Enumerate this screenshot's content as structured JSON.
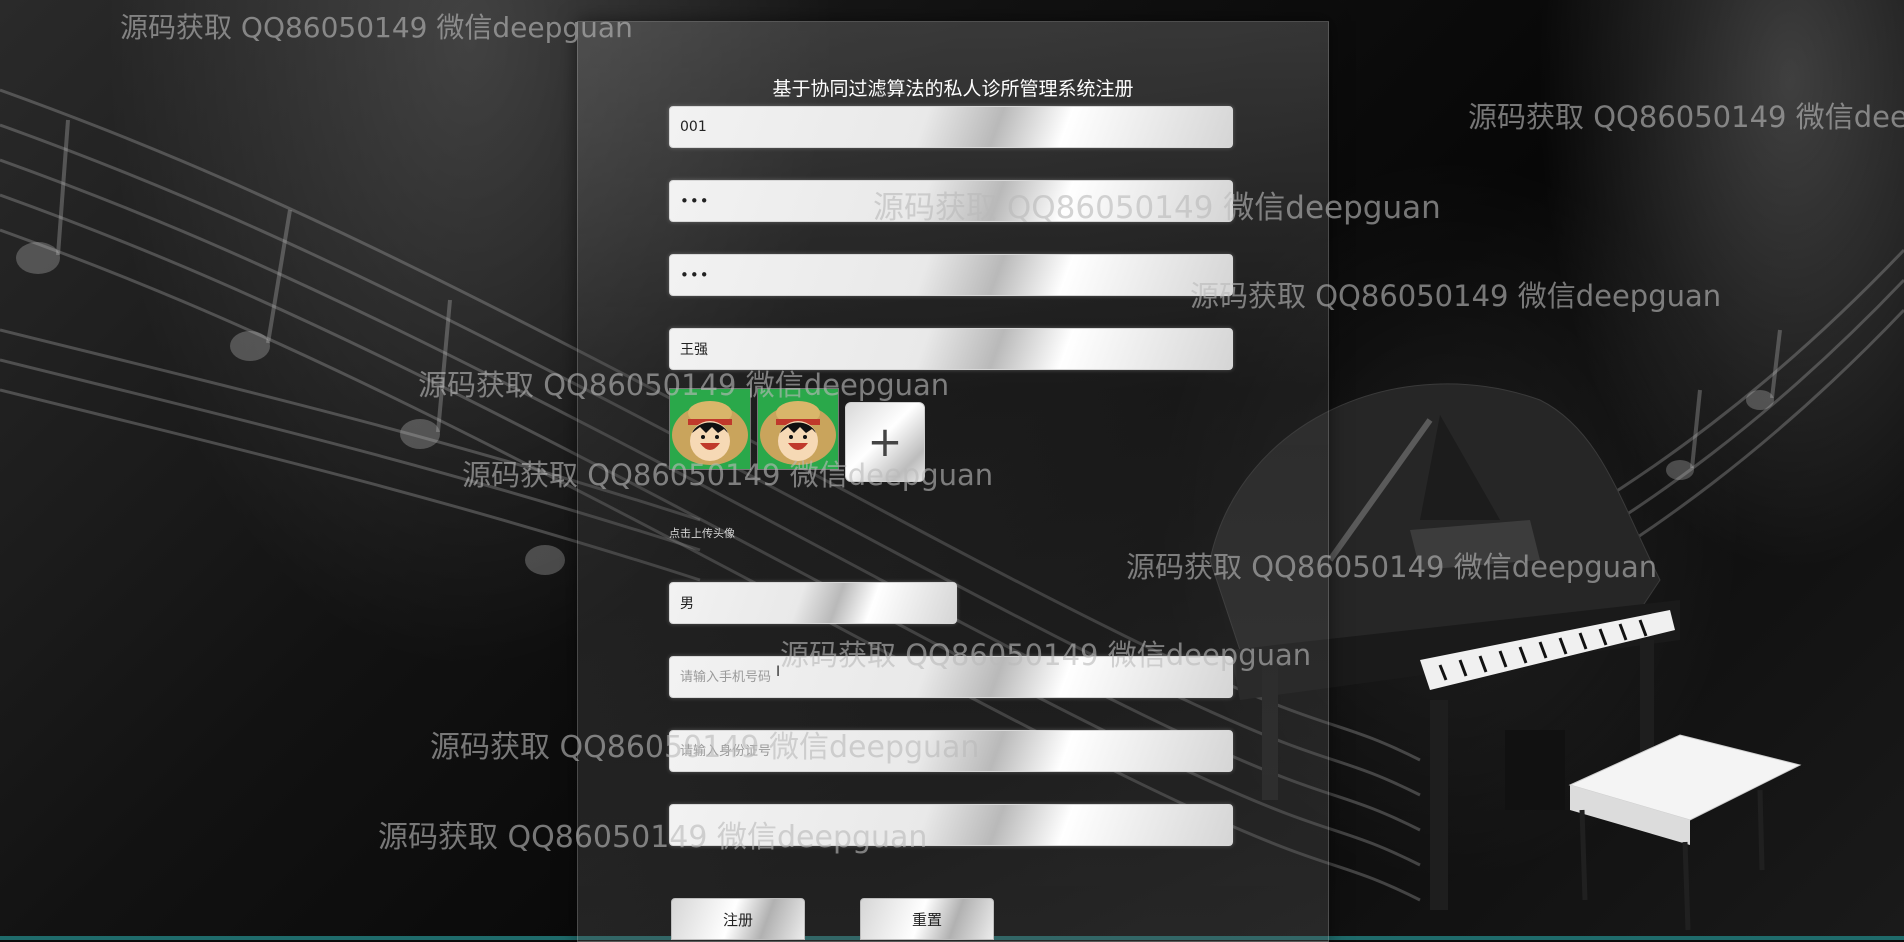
{
  "page": {
    "title": "基于协同过滤算法的私人诊所管理系统注册"
  },
  "form": {
    "username": {
      "value": "001",
      "placeholder": ""
    },
    "password": {
      "value": "111",
      "placeholder": ""
    },
    "confirm_password": {
      "value": "111",
      "placeholder": ""
    },
    "name": {
      "value": "王强",
      "placeholder": ""
    },
    "avatar": {
      "add_label": "+",
      "hint": "点击上传头像"
    },
    "gender": {
      "value": "男"
    },
    "phone": {
      "value": "",
      "placeholder": "请输入手机号码"
    },
    "id_card": {
      "value": "",
      "placeholder": "请输入身份证号"
    },
    "field_last": {
      "value": "",
      "placeholder": ""
    }
  },
  "buttons": {
    "register": "注册",
    "reset": "重置"
  },
  "watermark": {
    "text": "源码获取 QQ86050149 微信deepguan",
    "fragment_right": "源码获取 QQ86050149 微信dee"
  }
}
